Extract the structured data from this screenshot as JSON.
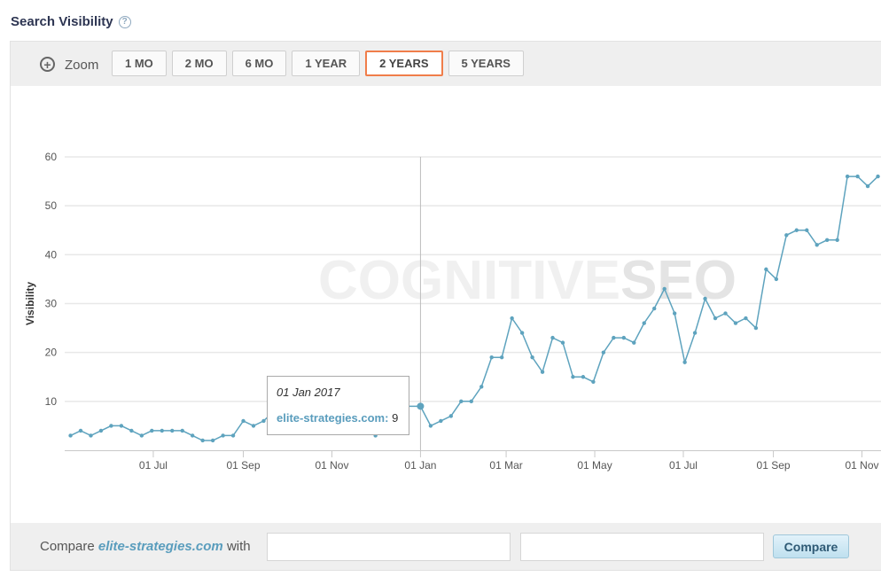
{
  "header": {
    "title": "Search Visibility",
    "help_icon": "?"
  },
  "toolbar": {
    "zoom_label": "Zoom",
    "zoom_icon": "+",
    "buttons": [
      "1 MO",
      "2 MO",
      "6 MO",
      "1 YEAR",
      "2 YEARS",
      "5 YEARS"
    ],
    "active": "2 YEARS"
  },
  "watermark": {
    "light": "COGNITIVE",
    "bold": "SEO"
  },
  "tooltip": {
    "date": "01 Jan 2017",
    "site": "elite-strategies.com:",
    "value": "9"
  },
  "compare": {
    "prefix": "Compare",
    "site": "elite-strategies.com",
    "suffix": "with",
    "button": "Compare",
    "input1": "",
    "input2": ""
  },
  "colors": {
    "line": "#5ea3be",
    "active_border": "#f07d4a",
    "grid": "#e8e8e8"
  },
  "chart_data": {
    "type": "line",
    "ylabel": "Visibility",
    "ylim": [
      0,
      60
    ],
    "yticks": [
      10,
      20,
      30,
      40,
      50,
      60
    ],
    "x_tick_labels": [
      "01 Jul",
      "01 Sep",
      "01 Nov",
      "01 Jan",
      "01 Mar",
      "01 May",
      "01 Jul",
      "01 Sep",
      "01 Nov"
    ],
    "x_tick_dates": [
      "2016-07-01",
      "2016-09-01",
      "2016-11-01",
      "2017-01-01",
      "2017-03-01",
      "2017-05-01",
      "2017-07-01",
      "2017-09-01",
      "2017-11-01"
    ],
    "x_range": [
      "2016-05-01",
      "2017-11-19"
    ],
    "highlight_date": "2017-01-01",
    "series": [
      {
        "name": "elite-strategies.com",
        "points": [
          [
            "2016-05-05",
            3
          ],
          [
            "2016-05-12",
            4
          ],
          [
            "2016-05-19",
            3
          ],
          [
            "2016-05-26",
            4
          ],
          [
            "2016-06-02",
            5
          ],
          [
            "2016-06-09",
            5
          ],
          [
            "2016-06-16",
            4
          ],
          [
            "2016-06-23",
            3
          ],
          [
            "2016-06-30",
            4
          ],
          [
            "2016-07-07",
            4
          ],
          [
            "2016-07-14",
            4
          ],
          [
            "2016-07-21",
            4
          ],
          [
            "2016-07-28",
            3
          ],
          [
            "2016-08-04",
            2
          ],
          [
            "2016-08-11",
            2
          ],
          [
            "2016-08-18",
            3
          ],
          [
            "2016-08-25",
            3
          ],
          [
            "2016-09-01",
            6
          ],
          [
            "2016-09-08",
            5
          ],
          [
            "2016-09-15",
            6
          ],
          [
            "2016-09-22",
            8
          ],
          [
            "2016-09-29",
            6
          ],
          [
            "2016-10-06",
            11
          ],
          [
            "2016-10-13",
            10
          ],
          [
            "2016-10-20",
            8
          ],
          [
            "2016-10-27",
            4
          ],
          [
            "2016-11-03",
            8
          ],
          [
            "2016-11-10",
            8
          ],
          [
            "2016-11-17",
            8
          ],
          [
            "2016-11-24",
            6
          ],
          [
            "2016-12-01",
            3
          ],
          [
            "2016-12-08",
            9
          ],
          [
            "2016-12-15",
            9
          ],
          [
            "2017-01-01",
            9
          ],
          [
            "2017-01-08",
            5
          ],
          [
            "2017-01-15",
            6
          ],
          [
            "2017-01-22",
            7
          ],
          [
            "2017-01-29",
            10
          ],
          [
            "2017-02-05",
            10
          ],
          [
            "2017-02-12",
            13
          ],
          [
            "2017-02-19",
            19
          ],
          [
            "2017-02-26",
            19
          ],
          [
            "2017-03-05",
            27
          ],
          [
            "2017-03-12",
            24
          ],
          [
            "2017-03-19",
            19
          ],
          [
            "2017-03-26",
            16
          ],
          [
            "2017-04-02",
            23
          ],
          [
            "2017-04-09",
            22
          ],
          [
            "2017-04-16",
            15
          ],
          [
            "2017-04-23",
            15
          ],
          [
            "2017-04-30",
            14
          ],
          [
            "2017-05-07",
            20
          ],
          [
            "2017-05-14",
            23
          ],
          [
            "2017-05-21",
            23
          ],
          [
            "2017-05-28",
            22
          ],
          [
            "2017-06-04",
            26
          ],
          [
            "2017-06-11",
            29
          ],
          [
            "2017-06-18",
            33
          ],
          [
            "2017-06-25",
            28
          ],
          [
            "2017-07-02",
            18
          ],
          [
            "2017-07-09",
            24
          ],
          [
            "2017-07-16",
            31
          ],
          [
            "2017-07-23",
            27
          ],
          [
            "2017-07-30",
            28
          ],
          [
            "2017-08-06",
            26
          ],
          [
            "2017-08-13",
            27
          ],
          [
            "2017-08-20",
            25
          ],
          [
            "2017-08-27",
            37
          ],
          [
            "2017-09-03",
            35
          ],
          [
            "2017-09-10",
            44
          ],
          [
            "2017-09-17",
            45
          ],
          [
            "2017-09-24",
            45
          ],
          [
            "2017-10-01",
            42
          ],
          [
            "2017-10-08",
            43
          ],
          [
            "2017-10-15",
            43
          ],
          [
            "2017-10-22",
            56
          ],
          [
            "2017-10-29",
            56
          ],
          [
            "2017-11-05",
            54
          ],
          [
            "2017-11-12",
            56
          ]
        ]
      }
    ]
  }
}
